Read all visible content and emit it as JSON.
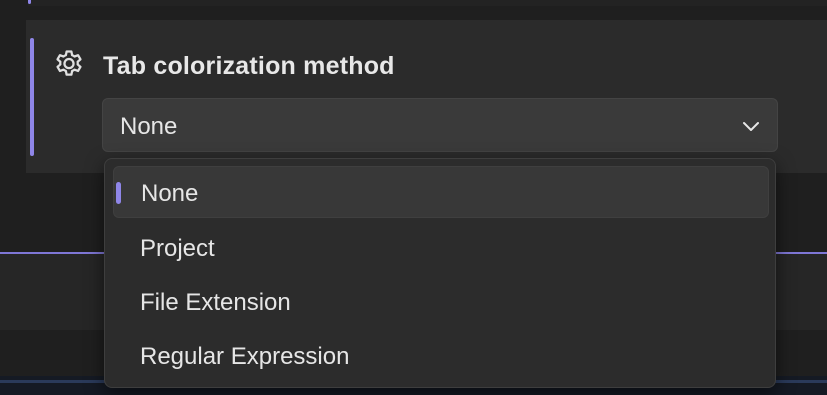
{
  "setting": {
    "title": "Tab colorization method",
    "icon": "gear-icon",
    "selected_value": "None"
  },
  "dropdown": {
    "icon": "chevron-down-icon",
    "selected_index": 0,
    "options": [
      {
        "label": "None"
      },
      {
        "label": "Project"
      },
      {
        "label": "File Extension"
      },
      {
        "label": "Regular Expression"
      }
    ]
  },
  "colors": {
    "accent": "#8f86e8",
    "background": "#1f1f1f",
    "card": "#2b2b2b",
    "popup": "#2c2c2c"
  }
}
